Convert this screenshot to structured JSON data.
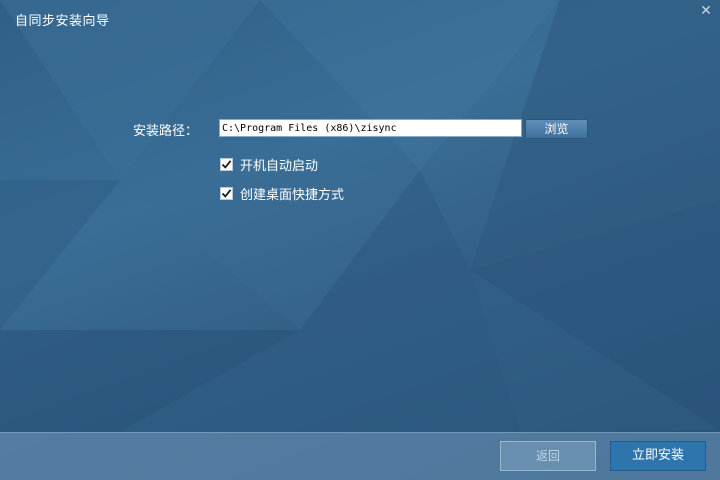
{
  "window": {
    "title": "自同步安装向导",
    "close_glyph": "✕"
  },
  "install_path": {
    "label": "安装路径：",
    "value": "C:\\Program Files (x86)\\zisync",
    "browse_label": "浏览"
  },
  "options": [
    {
      "label": "开机自动启动",
      "checked": true
    },
    {
      "label": "创建桌面快捷方式",
      "checked": true
    }
  ],
  "footer": {
    "back_label": "返回",
    "install_label": "立即安装"
  },
  "colors": {
    "background": "#356589",
    "primary_button": "#2e74ad",
    "footer_bar": "#6e96b9"
  }
}
